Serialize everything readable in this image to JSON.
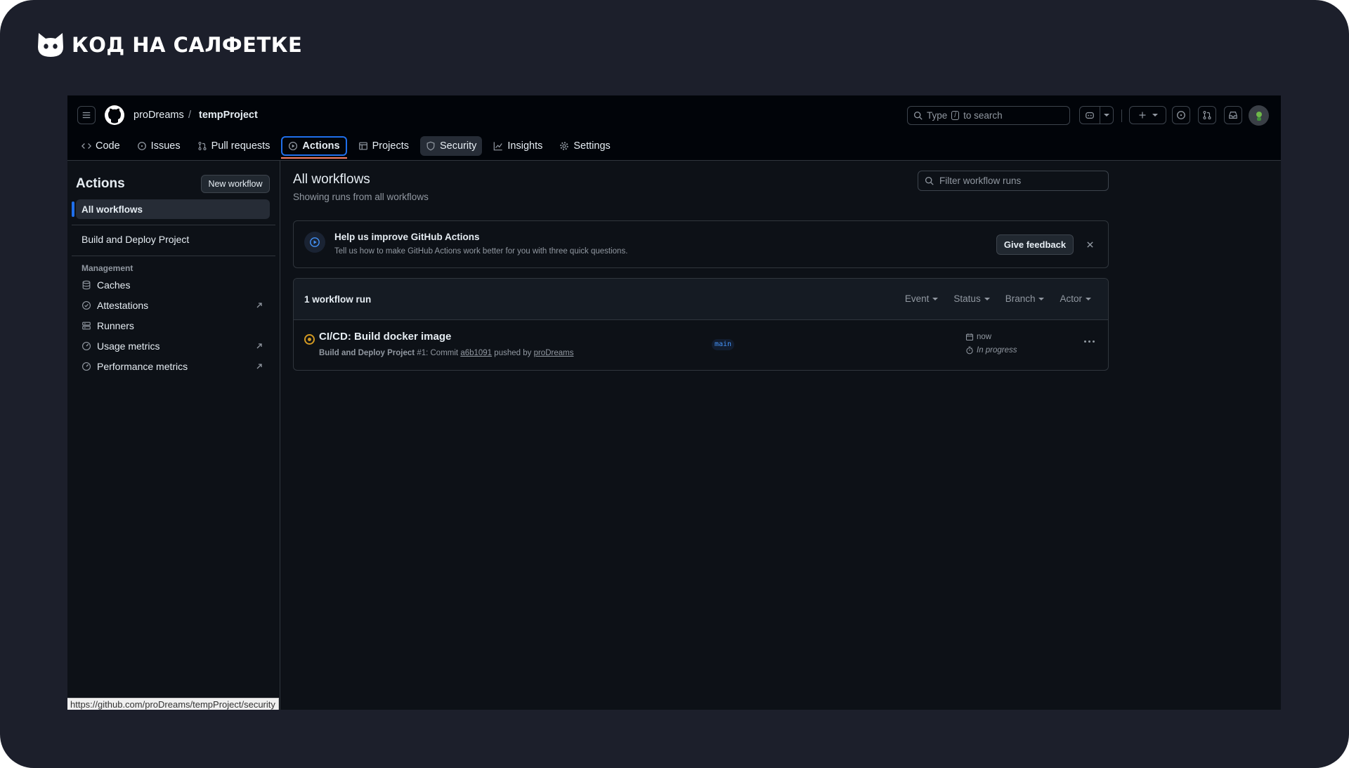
{
  "brand": {
    "name": "КОД НА САЛФЕТКЕ"
  },
  "header": {
    "owner": "proDreams",
    "separator": "/",
    "repo": "tempProject",
    "search": {
      "prefix": "Type",
      "key": "/",
      "suffix": "to search"
    }
  },
  "tabs": [
    {
      "label": "Code",
      "icon": "code-icon"
    },
    {
      "label": "Issues",
      "icon": "issue-opened-icon"
    },
    {
      "label": "Pull requests",
      "icon": "git-pull-request-icon"
    },
    {
      "label": "Actions",
      "icon": "play-icon",
      "selected": true
    },
    {
      "label": "Projects",
      "icon": "table-icon"
    },
    {
      "label": "Security",
      "icon": "shield-icon",
      "hovered": true
    },
    {
      "label": "Insights",
      "icon": "graph-icon"
    },
    {
      "label": "Settings",
      "icon": "gear-icon"
    }
  ],
  "sidebar": {
    "title": "Actions",
    "new_workflow": "New workflow",
    "all_workflows": "All workflows",
    "workflows": [
      "Build and Deploy Project"
    ],
    "management_heading": "Management",
    "management": [
      {
        "label": "Caches",
        "icon": "database-icon",
        "external": false
      },
      {
        "label": "Attestations",
        "icon": "verified-icon",
        "external": true
      },
      {
        "label": "Runners",
        "icon": "server-icon",
        "external": false
      },
      {
        "label": "Usage metrics",
        "icon": "meter-icon",
        "external": true
      },
      {
        "label": "Performance metrics",
        "icon": "meter-icon",
        "external": true
      }
    ]
  },
  "main": {
    "title": "All workflows",
    "subtitle": "Showing runs from all workflows",
    "filter_placeholder": "Filter workflow runs",
    "feedback": {
      "title": "Help us improve GitHub Actions",
      "text": "Tell us how to make GitHub Actions work better for you with three quick questions.",
      "button": "Give feedback"
    },
    "runs": {
      "count_label": "1 workflow run",
      "filters": [
        "Event",
        "Status",
        "Branch",
        "Actor"
      ],
      "items": [
        {
          "title": "CI/CD: Build docker image",
          "workflow": "Build and Deploy Project",
          "run_number": "#1",
          "meta_mid": ": Commit",
          "commit": "a6b1091",
          "pushed_by": "pushed by",
          "actor": "proDreams",
          "branch": "main",
          "time": "now",
          "status": "In progress"
        }
      ]
    }
  },
  "statusbar": {
    "url": "https://github.com/proDreams/tempProject/security"
  },
  "colors": {
    "accent": "#1f6feb",
    "underline": "#f78166",
    "in_progress": "#d29922"
  }
}
